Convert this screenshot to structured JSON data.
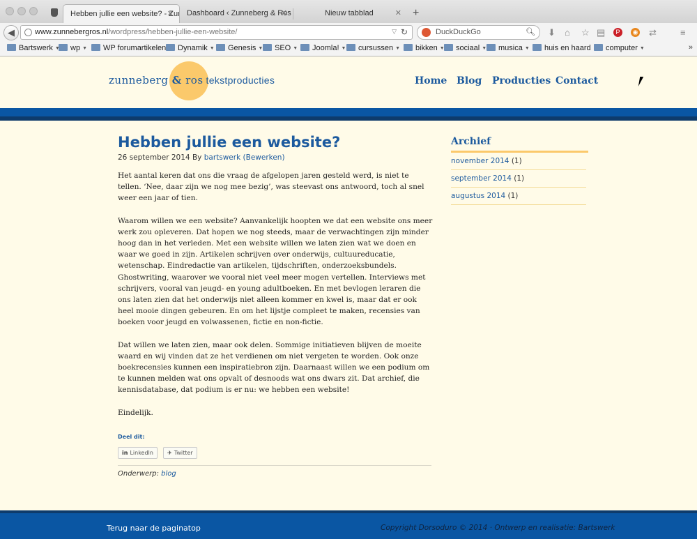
{
  "browser": {
    "tabs": [
      {
        "title": "Hebben jullie een website? - Zun..."
      },
      {
        "title": "Dashboard ‹ Zunneberg & Ros ..."
      },
      {
        "title": "Nieuw tabblad"
      }
    ],
    "url": {
      "domain": "www.zunnebergros.nl",
      "path": "/wordpress/hebben-jullie-een-website/"
    },
    "search_placeholder": "DuckDuckGo",
    "bookmarks": [
      "Bartswerk",
      "wp",
      "WP forumartikelen",
      "Dynamik",
      "Genesis",
      "SEO",
      "Joomla!",
      "cursussen",
      "bikken",
      "sociaal",
      "musica",
      "huis en haard",
      "computer"
    ]
  },
  "site": {
    "logo": {
      "name_part1": "zunneberg",
      "amp": "&",
      "name_part2": "ros",
      "tagline": "tekstproducties"
    },
    "nav": [
      "Home",
      "Blog",
      "Producties",
      "Contact"
    ],
    "colors": {
      "brand_blue": "#0a56a3",
      "dark_blue": "#0e3b6b",
      "accent_yellow": "#fbc96b",
      "background": "#fffbe8"
    }
  },
  "post": {
    "title": "Hebben jullie een website?",
    "date": "26 september 2014",
    "by": "By",
    "author": "bartswerk",
    "edit": "(Bewerken)",
    "paragraphs": [
      "Het aantal keren dat ons die vraag de afgelopen jaren gesteld werd, is niet te tellen. ‘Nee, daar zijn we nog mee bezig’, was steevast ons antwoord, toch al snel weer een jaar of tien.",
      "Waarom willen we een website? Aanvankelijk hoopten we dat een website ons meer werk zou opleveren. Dat hopen we nog steeds, maar de verwachtingen zijn minder hoog dan in het verleden. Met een website willen we laten zien wat we doen en waar we goed in zijn. Artikelen schrijven over onderwijs, cultuureducatie, wetenschap. Eindredactie van artikelen, tijdschriften, onderzoeksbundels. Ghostwriting, waarover we vooral niet veel meer mogen vertellen. Interviews met schrijvers, vooral van jeugd- en young adultboeken. En met bevlogen leraren die ons laten zien dat het onderwijs niet alleen kommer en kwel is, maar dat er ook heel mooie dingen gebeuren. En om het lijstje compleet te maken, recensies van boeken voor jeugd en volwassenen, fictie en non-fictie.",
      "Dat willen we laten zien, maar ook delen. Sommige initiatieven blijven de moeite waard en wij vinden dat ze het verdienen om niet vergeten te worden. Ook onze boekrecensies kunnen een inspiratiebron zijn. Daarnaast willen we een podium om te kunnen melden wat ons opvalt of desnoods wat ons dwars zit. Dat archief, die kennisdatabase, dat podium is er nu: we hebben een website!",
      "Eindelijk."
    ],
    "share_label": "Deel dit:",
    "share_buttons": [
      "LinkedIn",
      "Twitter"
    ],
    "category_label": "Onderwerp:",
    "category": "blog"
  },
  "sidebar": {
    "title": "Archief",
    "items": [
      {
        "label": "november 2014",
        "count": "(1)"
      },
      {
        "label": "september 2014",
        "count": "(1)"
      },
      {
        "label": "augustus 2014",
        "count": "(1)"
      }
    ]
  },
  "footer": {
    "back_to_top": "Terug naar de paginatop",
    "copyright": "Copyright Dorsoduro © 2014 · Ontwerp en realisatie: Bartswerk"
  }
}
